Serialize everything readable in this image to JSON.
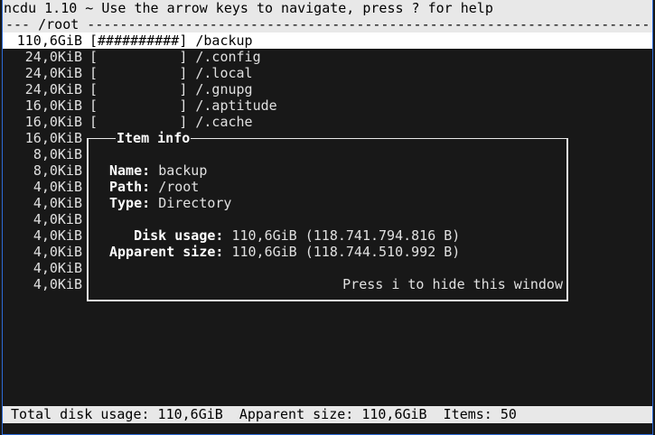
{
  "title_bar": "ncdu 1.10 ~ Use the arrow keys to navigate, press ? for help",
  "path_bar": "--- /root ------------------------------------------------------------------------------------",
  "rows": [
    {
      "size": "110,6GiB",
      "bar": "[##########]",
      "name": "/backup",
      "selected": true
    },
    {
      "size": "24,0KiB",
      "bar": "[          ]",
      "name": "/.config"
    },
    {
      "size": "24,0KiB",
      "bar": "[          ]",
      "name": "/.local"
    },
    {
      "size": "24,0KiB",
      "bar": "[          ]",
      "name": "/.gnupg"
    },
    {
      "size": "16,0KiB",
      "bar": "[          ]",
      "name": "/.aptitude"
    },
    {
      "size": "16,0KiB",
      "bar": "[          ]",
      "name": "/.cache"
    },
    {
      "size": "16,0KiB",
      "bar": "",
      "name": ""
    },
    {
      "size": "8,0KiB",
      "bar": "",
      "name": ""
    },
    {
      "size": "8,0KiB",
      "bar": "",
      "name": ""
    },
    {
      "size": "4,0KiB",
      "bar": "",
      "name": ""
    },
    {
      "size": "4,0KiB",
      "bar": "",
      "name": ""
    },
    {
      "size": "4,0KiB",
      "bar": "",
      "name": ""
    },
    {
      "size": "4,0KiB",
      "bar": "",
      "name": ""
    },
    {
      "size": "4,0KiB",
      "bar": "",
      "name": ""
    },
    {
      "size": "4,0KiB",
      "bar": "",
      "name": ""
    },
    {
      "size": "4,0KiB",
      "bar": "",
      "name": ""
    }
  ],
  "item_info": {
    "title": "Item info",
    "name_label": "Name:",
    "name_value": "backup",
    "path_label": "Path:",
    "path_value": "/root",
    "type_label": "Type:",
    "type_value": "Directory",
    "disk_usage_label": "Disk usage:",
    "disk_usage_value": "110,6GiB (118.741.794.816 B)",
    "apparent_size_label": "Apparent size:",
    "apparent_size_value": "110,6GiB (118.744.510.992 B)",
    "hint": "Press i to hide this window"
  },
  "status_bar": "Total disk usage: 110,6GiB  Apparent size: 110,6GiB  Items: 50",
  "colors": {
    "background": "#181818",
    "foreground": "#e0e0e0",
    "bar_background": "#e8e8e8",
    "window_border": "#2d6bd6"
  }
}
